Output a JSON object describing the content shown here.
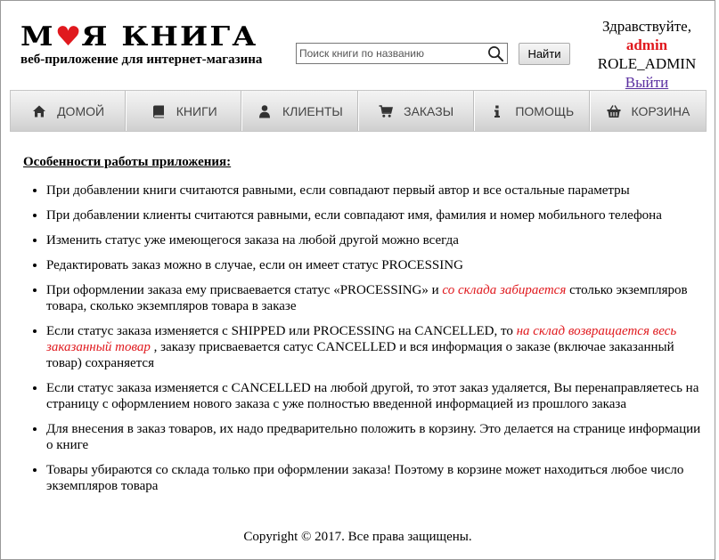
{
  "header": {
    "logo": {
      "word1_a": "М",
      "word1_b": "Я",
      "heart": "♥",
      "word2": "КНИГА",
      "subtitle": "веб-приложение для интернет-магазина"
    },
    "search": {
      "placeholder": "Поиск книги по названию",
      "value": "",
      "button_label": "Найти",
      "icon": "search-icon"
    },
    "user": {
      "greeting": "Здравствуйте,",
      "username": "admin",
      "role": "ROLE_ADMIN",
      "logout_label": "Выйти"
    }
  },
  "nav": {
    "items": [
      {
        "label": "ДОМОЙ",
        "icon": "home-icon"
      },
      {
        "label": "КНИГИ",
        "icon": "book-icon"
      },
      {
        "label": "КЛИЕНТЫ",
        "icon": "user-icon"
      },
      {
        "label": "ЗАКАЗЫ",
        "icon": "cart-icon"
      },
      {
        "label": "ПОМОЩЬ",
        "icon": "info-icon"
      },
      {
        "label": "КОРЗИНА",
        "icon": "basket-icon"
      }
    ]
  },
  "content": {
    "title": "Особенности работы приложения:",
    "rules": [
      {
        "text": "При добавлении книги считаются равными, если совпадают первый автор и все остальные параметры"
      },
      {
        "text": "При добавлении клиенты считаются равными, если совпадают имя, фамилия и номер мобильного телефона"
      },
      {
        "text": "Изменить статус уже имеющегося заказа на любой другой можно всегда"
      },
      {
        "text": "Редактировать заказ можно в случае, если он имеет статус PROCESSING"
      },
      {
        "before": "При оформлении заказа ему присваевается статус «PROCESSING» и ",
        "highlight": "со склада забирается",
        "after": " столько экземпляров товара, сколько экземпляров товара в заказе"
      },
      {
        "before": "Если статус заказа изменяется с SHIPPED или PROCESSING на CANCELLED, то ",
        "highlight": "на склад возвращается весь заказанный товар",
        "after": " , заказу присваевается сатус CANCELLED и вся информация о заказе (включае заказанный товар) сохраняется"
      },
      {
        "text": "Если статус заказа изменяется с CANCELLED на любой другой, то этот заказ удаляется, Вы перенаправляетесь на страницу с оформлением нового заказа с уже полностью введенной информацией из прошлого заказа"
      },
      {
        "text": "Для внесения в заказ товаров, их надо предварительно положить в корзину. Это делается на странице информации о книге"
      },
      {
        "text": "Товары убираются со склада только при оформлении заказа! Поэтому в корзине может находиться любое число экземпляров товара"
      }
    ]
  },
  "footer": {
    "copyright": "Copyright © 2017. Все права защищены."
  },
  "colors": {
    "accent": "#e0191e",
    "link": "#5a2fa0",
    "nav_text": "#444444"
  }
}
